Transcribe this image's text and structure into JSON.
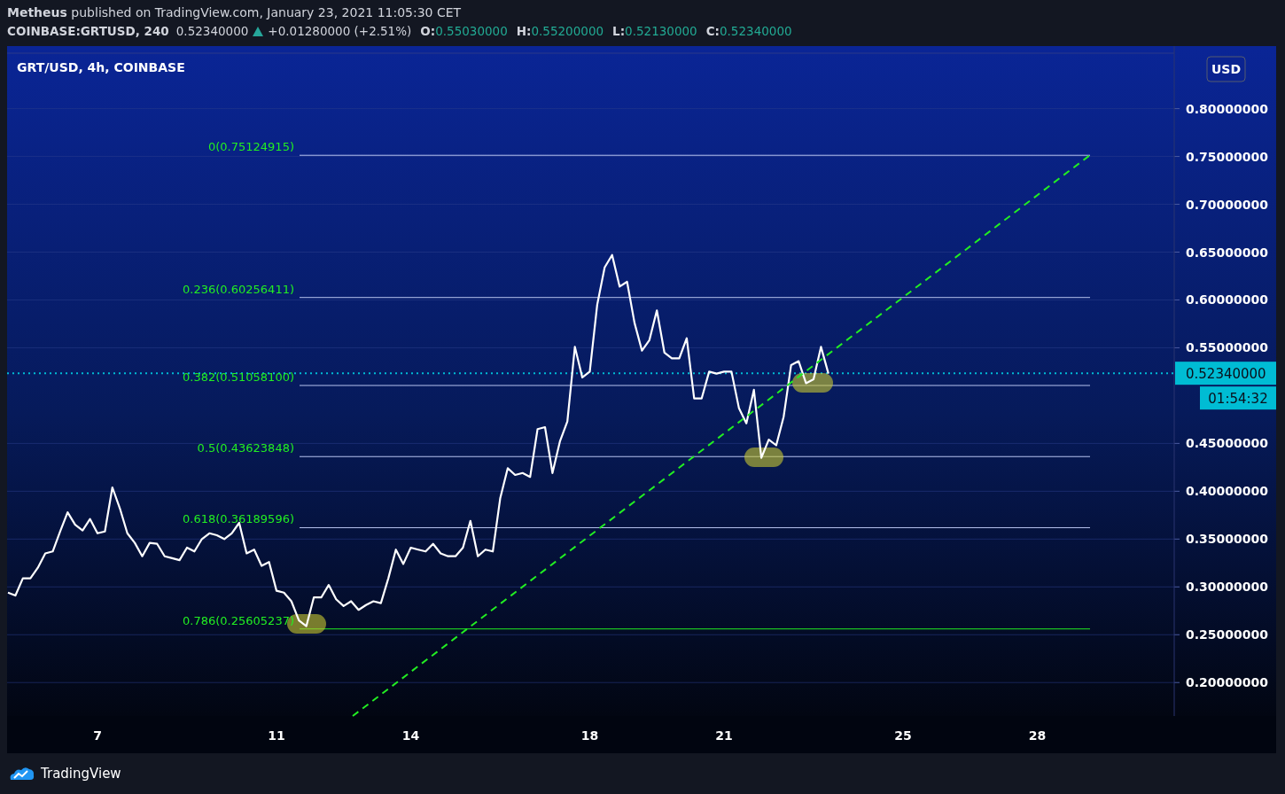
{
  "header": {
    "published": "**Metheus** published on TradingView.com, January 23, 2021 11:05:30 CET"
  },
  "symbol_bar": {
    "symbol": "COINBASE:GRTUSD, 240",
    "price": "0.52340000",
    "rising": true,
    "change": "+0.01280000 (+2.51%)",
    "ohlc": [
      {
        "label": "O:",
        "value": "0.55030000"
      },
      {
        "label": "H:",
        "value": "0.55200000"
      },
      {
        "label": "L:",
        "value": "0.52130000"
      },
      {
        "label": "C:",
        "value": "0.52340000"
      }
    ]
  },
  "chart": {
    "legend": "GRT/USD, 4h, COINBASE",
    "currency": "USD",
    "last_price": "0.52340000",
    "countdown": "01:54:32",
    "chart_data": {
      "type": "line",
      "grid": true,
      "xlim": [
        4.98,
        31.06
      ],
      "ylim": [
        0.165,
        0.858
      ],
      "xticks": [
        7,
        11,
        14,
        18,
        21,
        25,
        28
      ],
      "yticks": [
        {
          "value": 0.2,
          "label": "0.20000000"
        },
        {
          "value": 0.25,
          "label": "0.25000000"
        },
        {
          "value": 0.3,
          "label": "0.30000000"
        },
        {
          "value": 0.35,
          "label": "0.35000000"
        },
        {
          "value": 0.4,
          "label": "0.40000000"
        },
        {
          "value": 0.45,
          "label": "0.45000000"
        },
        {
          "value": 0.55,
          "label": "0.55000000"
        },
        {
          "value": 0.6,
          "label": "0.60000000"
        },
        {
          "value": 0.65,
          "label": "0.65000000"
        },
        {
          "value": 0.7,
          "label": "0.70000000"
        },
        {
          "value": 0.75,
          "label": "0.75000000"
        },
        {
          "value": 0.8,
          "label": "0.80000000"
        }
      ],
      "x": [
        5,
        5.167,
        5.333,
        5.5,
        5.667,
        5.833,
        6,
        6.167,
        6.333,
        6.5,
        6.667,
        6.833,
        7,
        7.167,
        7.333,
        7.5,
        7.667,
        7.833,
        8,
        8.167,
        8.333,
        8.5,
        8.667,
        8.833,
        9,
        9.167,
        9.333,
        9.5,
        9.667,
        9.833,
        10,
        10.167,
        10.333,
        10.5,
        10.667,
        10.833,
        11,
        11.167,
        11.333,
        11.5,
        11.667,
        11.833,
        12,
        12.167,
        12.333,
        12.5,
        12.667,
        12.833,
        13,
        13.167,
        13.333,
        13.5,
        13.667,
        13.833,
        14,
        14.167,
        14.333,
        14.5,
        14.667,
        14.833,
        15,
        15.167,
        15.333,
        15.5,
        15.667,
        15.833,
        16,
        16.167,
        16.333,
        16.5,
        16.667,
        16.833,
        17,
        17.167,
        17.333,
        17.5,
        17.667,
        17.833,
        18,
        18.167,
        18.333,
        18.5,
        18.667,
        18.833,
        19,
        19.167,
        19.333,
        19.5,
        19.667,
        19.833,
        20,
        20.167,
        20.333,
        20.5,
        20.667,
        20.833,
        21,
        21.167,
        21.333,
        21.5,
        21.667,
        21.833,
        22,
        22.167,
        22.333,
        22.5,
        22.667,
        22.833,
        23,
        23.167,
        23.333
      ],
      "series": [
        {
          "color": "#ffffff",
          "values": [
            0.294,
            0.291,
            0.309,
            0.309,
            0.32,
            0.335,
            0.337,
            0.358,
            0.378,
            0.365,
            0.359,
            0.371,
            0.356,
            0.358,
            0.404,
            0.382,
            0.356,
            0.346,
            0.332,
            0.346,
            0.345,
            0.332,
            0.33,
            0.328,
            0.341,
            0.337,
            0.35,
            0.356,
            0.354,
            0.35,
            0.356,
            0.367,
            0.335,
            0.339,
            0.322,
            0.326,
            0.296,
            0.294,
            0.285,
            0.265,
            0.259,
            0.289,
            0.289,
            0.302,
            0.287,
            0.28,
            0.285,
            0.276,
            0.281,
            0.285,
            0.283,
            0.309,
            0.339,
            0.324,
            0.341,
            0.339,
            0.337,
            0.345,
            0.335,
            0.332,
            0.332,
            0.341,
            0.369,
            0.332,
            0.339,
            0.337,
            0.393,
            0.424,
            0.417,
            0.419,
            0.415,
            0.465,
            0.467,
            0.419,
            0.452,
            0.473,
            0.551,
            0.519,
            0.525,
            0.595,
            0.634,
            0.647,
            0.614,
            0.619,
            0.576,
            0.547,
            0.558,
            0.589,
            0.545,
            0.539,
            0.539,
            0.56,
            0.497,
            0.497,
            0.525,
            0.523,
            0.525,
            0.525,
            0.487,
            0.471,
            0.506,
            0.435,
            0.454,
            0.448,
            0.478,
            0.532,
            0.536,
            0.513,
            0.517,
            0.551,
            0.523
          ]
        }
      ],
      "ref_lines": [
        {
          "axis": "y",
          "value": 0.75124915,
          "label": "0(0.75124915)",
          "color": "#b8c4f0"
        },
        {
          "axis": "y",
          "value": 0.60256411,
          "label": "0.236(0.60256411)",
          "color": "#b8c4f0"
        },
        {
          "axis": "y",
          "value": 0.510581,
          "label": "0.382(0.51058100)",
          "color": "#b8c4f0"
        },
        {
          "axis": "y",
          "value": 0.43623848,
          "label": "0.5(0.43623848)",
          "color": "#b8c4f0"
        },
        {
          "axis": "y",
          "value": 0.36189596,
          "label": "0.618(0.36189596)",
          "color": "#b8c4f0"
        },
        {
          "axis": "y",
          "value": 0.25605237,
          "label": "0.786(0.25605237)",
          "color": "#22ee22"
        },
        {
          "axis": "y",
          "value": 0.5234,
          "color": "#00bcd4"
        }
      ]
    }
  },
  "footer": {
    "brand": "TradingView"
  }
}
